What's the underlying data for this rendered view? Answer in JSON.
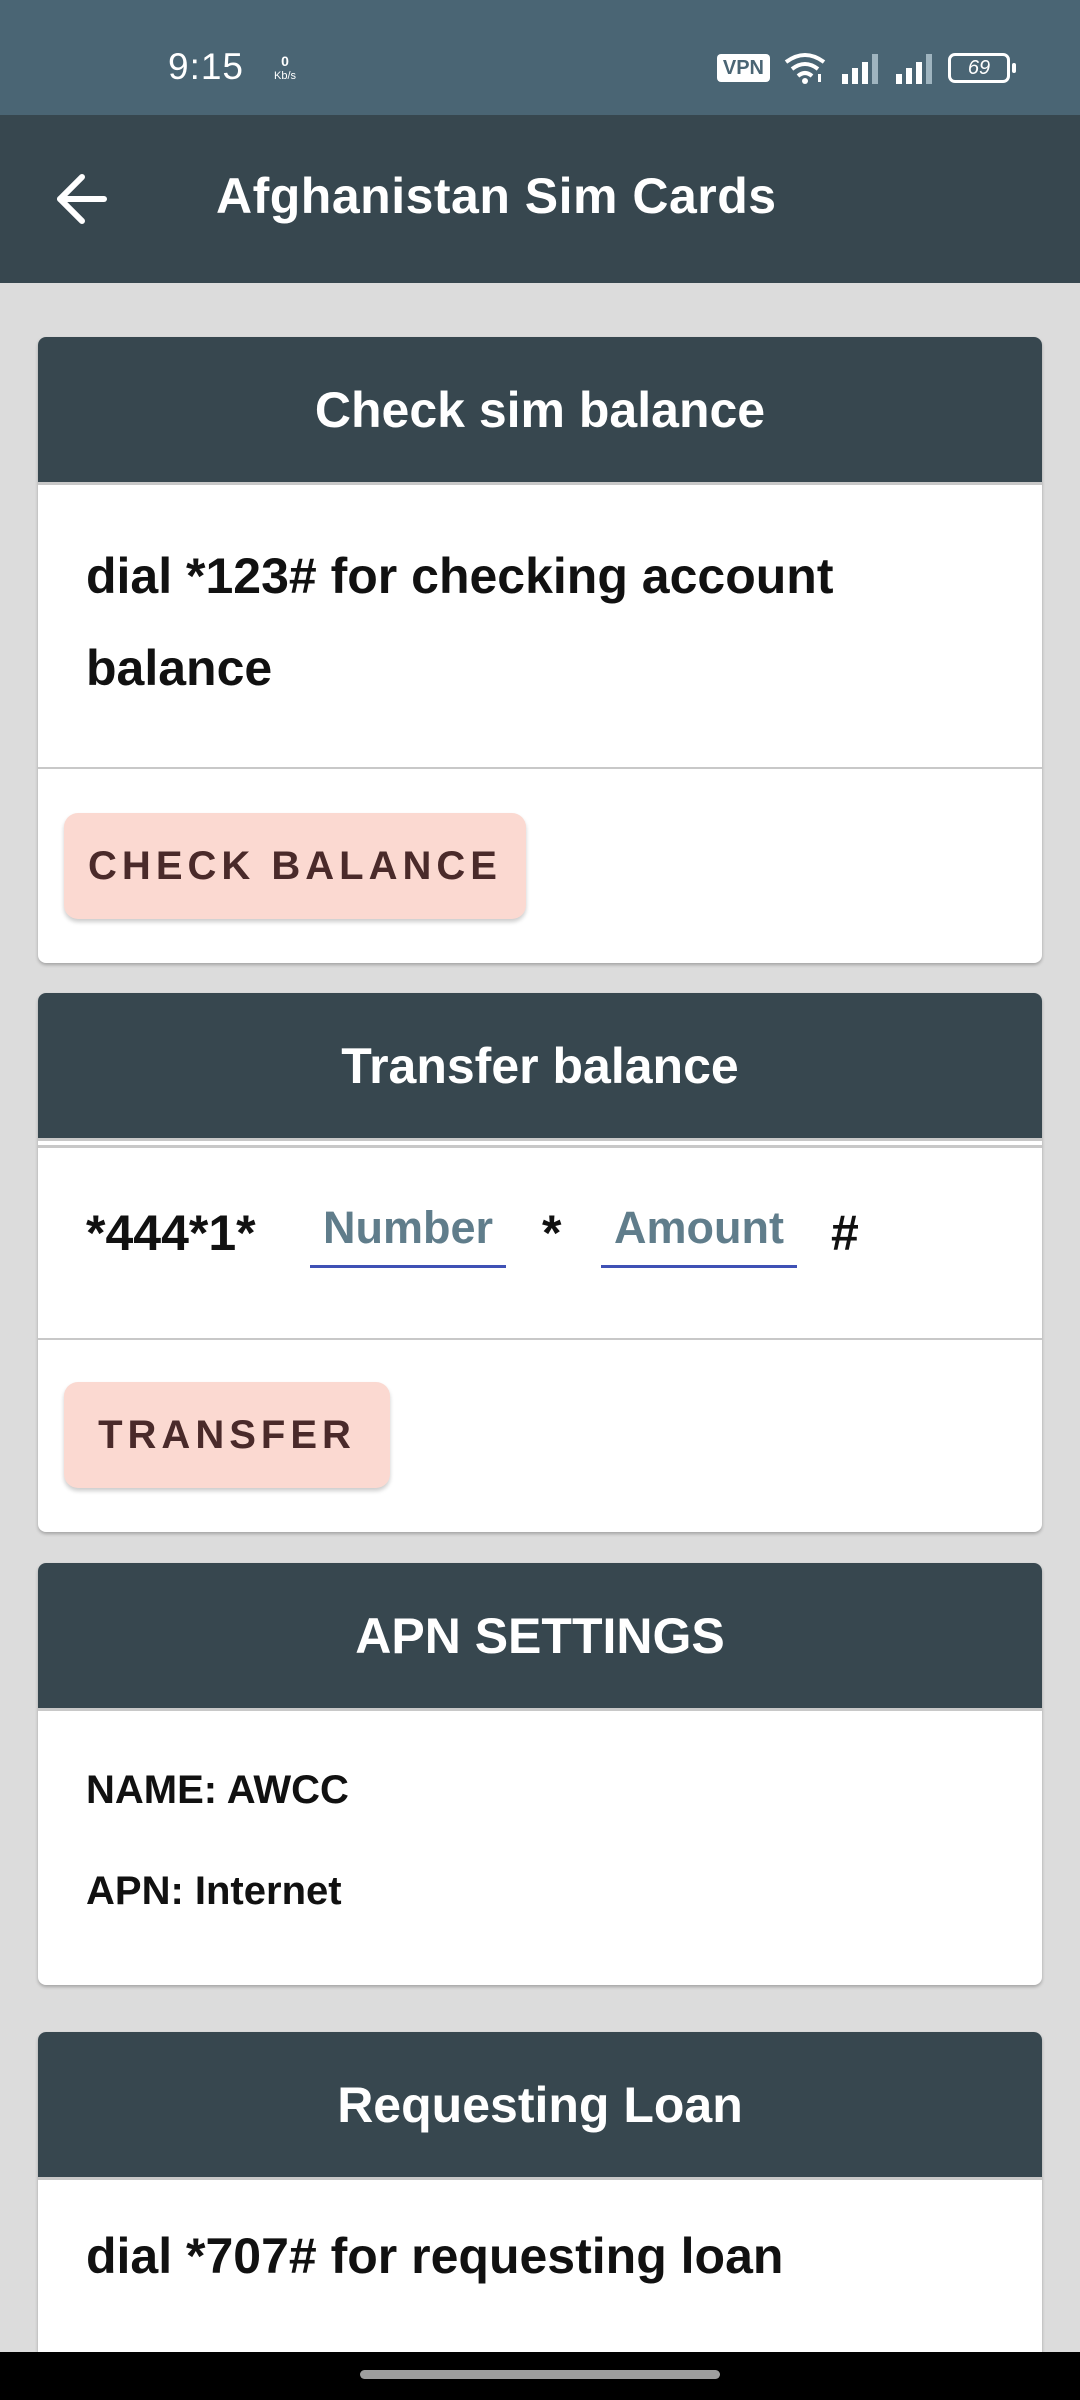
{
  "status_bar": {
    "time": "9:15",
    "net_speed": "0",
    "net_unit": "Kb/s",
    "vpn": "VPN",
    "battery": "69"
  },
  "app_bar": {
    "title": "Afghanistan Sim Cards",
    "back_icon": "arrow-left-icon"
  },
  "check_balance": {
    "title": "Check sim balance",
    "instruction": "dial *123# for checking account balance",
    "button": "CHECK BALANCE"
  },
  "transfer_balance": {
    "title": "Transfer balance",
    "prefix": "*444*1*",
    "number_placeholder": "Number",
    "separator": "*",
    "amount_placeholder": "Amount",
    "suffix": "#",
    "button": "TRANSFER"
  },
  "apn_settings": {
    "title": "APN SETTINGS",
    "name_line": "NAME: AWCC",
    "apn_line": "APN: Internet"
  },
  "requesting_loan": {
    "title": "Requesting Loan",
    "instruction": "dial *707# for requesting loan"
  },
  "colors": {
    "header": "#37474f",
    "status_bar": "#4a6574",
    "button_bg": "#fbd9d1",
    "input_underline": "#3f51b5"
  }
}
